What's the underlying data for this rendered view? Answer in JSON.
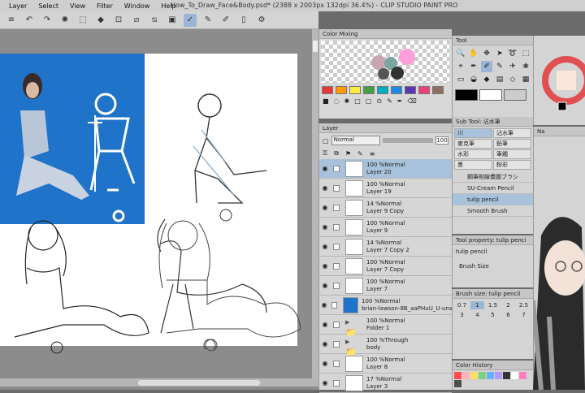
{
  "menu": [
    "Layer",
    "Select",
    "View",
    "Filter",
    "Window",
    "Help"
  ],
  "window_title": "How_To_Draw_Face&Body.psd* (2388 x 2003px 132dpi 36.4%) - CLIP STUDIO PAINT PRO",
  "toolbar_icons": [
    "undo-icon",
    "redo-icon",
    "spinner-icon",
    "bucket-icon",
    "transform-icon",
    "crop-icon",
    "hand-icon",
    "clear-icon",
    "pen-icon",
    "brush-icon",
    "pencil-icon",
    "device-icon",
    "settings-icon"
  ],
  "color_mixing": {
    "title": "Color Mixing",
    "swatches": [
      "#e53935",
      "#ff9800",
      "#ffeb3b",
      "#43a047",
      "#00acc1",
      "#1e88e5",
      "#5e35b1",
      "#ec407a",
      "#8d6e63",
      "#9e9e9e"
    ]
  },
  "layer_panel": {
    "title": "Layer",
    "blend": "Normal",
    "opacity": "100",
    "layers": [
      {
        "line1": "100 %Normal",
        "line2": "Layer 20",
        "selected": true,
        "type": "normal"
      },
      {
        "line1": "100 %Normal",
        "line2": "Layer 19",
        "selected": false,
        "type": "normal"
      },
      {
        "line1": "14 %Normal",
        "line2": "Layer 9 Copy",
        "selected": false,
        "type": "normal"
      },
      {
        "line1": "100 %Normal",
        "line2": "Layer 9",
        "selected": false,
        "type": "normal"
      },
      {
        "line1": "14 %Normal",
        "line2": "Layer 7 Copy 2",
        "selected": false,
        "type": "normal"
      },
      {
        "line1": "100 %Normal",
        "line2": "Layer 7 Copy",
        "selected": false,
        "type": "normal"
      },
      {
        "line1": "100 %Normal",
        "line2": "Layer 7",
        "selected": false,
        "type": "normal"
      },
      {
        "line1": "100 %Normal",
        "line2": "brian-lawson-8B_aaPHuU_U-unsplash",
        "selected": false,
        "type": "photo"
      },
      {
        "line1": "100 %Normal",
        "line2": "Folder 1",
        "selected": false,
        "type": "folder"
      },
      {
        "line1": "100 %Through",
        "line2": "body",
        "selected": false,
        "type": "folder"
      },
      {
        "line1": "100 %Normal",
        "line2": "Layer 8",
        "selected": false,
        "type": "normal"
      },
      {
        "line1": "17 %Normal",
        "line2": "Layer 3",
        "selected": false,
        "type": "normal"
      }
    ]
  },
  "tool_panel": {
    "title": "Tool"
  },
  "sub_tool": {
    "title": "Sub Tool: 沾水筆",
    "tabs": [
      "川",
      "沾水筆",
      "麥克筆",
      "鉛筆",
      "水彩",
      "筆觸",
      "墨",
      "粉彩"
    ],
    "brushes": [
      "鋼筆削線畫圖ブラシ",
      "SU-Cream Pencil",
      "tulip pencil",
      "Smooth Brush"
    ]
  },
  "tool_property": {
    "title": "Tool property: tulip penci",
    "label": "tulip pencil",
    "size_label": "Brush Size"
  },
  "brush_size": {
    "title": "Brush size: tulip pencil",
    "values": [
      "0.7",
      "1",
      "1.5",
      "2",
      "2.5",
      "3",
      "4",
      "5",
      "6",
      "7"
    ]
  },
  "color_history": {
    "title": "Color History",
    "colors": [
      "#ff4d4d",
      "#ffb3c1",
      "#ffe066",
      "#80d080",
      "#66b3ff",
      "#b399ff",
      "#333333",
      "#ffffff",
      "#ff80bf",
      "#4d4d4d"
    ]
  },
  "nav_label": "Na"
}
